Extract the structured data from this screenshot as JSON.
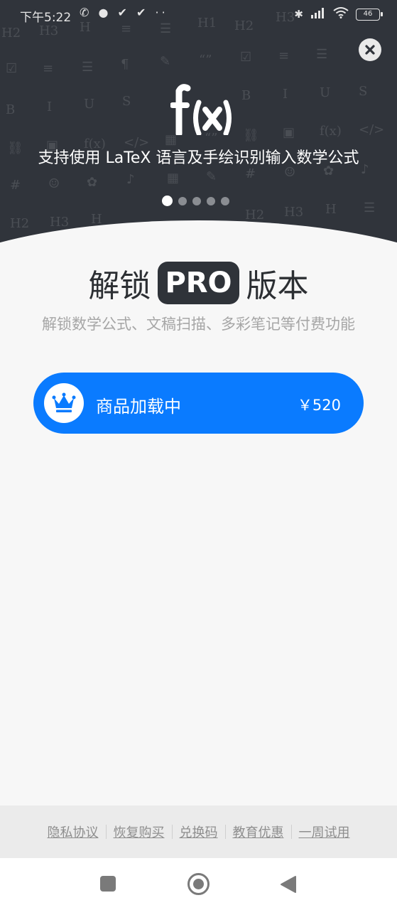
{
  "status_bar": {
    "time": "下午5:22",
    "notifications": "✆ ● ✔ ✔ ··",
    "battery": "46"
  },
  "hero": {
    "logo_text": "f(x)",
    "feature_text": "支持使用 LaTeX 语言及手绘识别输入数学公式",
    "pager_count": 5,
    "pager_active": 0
  },
  "main": {
    "title_prefix": "解锁",
    "title_badge": "PRO",
    "title_suffix": "版本",
    "subtitle": "解锁数学公式、文稿扫描、多彩笔记等付费功能",
    "buy_button": {
      "label": "商品加载中",
      "price": "￥520"
    }
  },
  "footer": {
    "links": [
      "隐私协议",
      "恢复购买",
      "兑换码",
      "教育优惠",
      "一周试用"
    ]
  },
  "colors": {
    "hero_bg": "#30343b",
    "accent": "#0a7bff",
    "page_bg": "#f7f7f7"
  },
  "icons": {
    "close": "close-icon",
    "crown": "crown-icon",
    "nav_recent": "recent-apps-icon",
    "nav_home": "home-icon",
    "nav_back": "back-icon"
  }
}
